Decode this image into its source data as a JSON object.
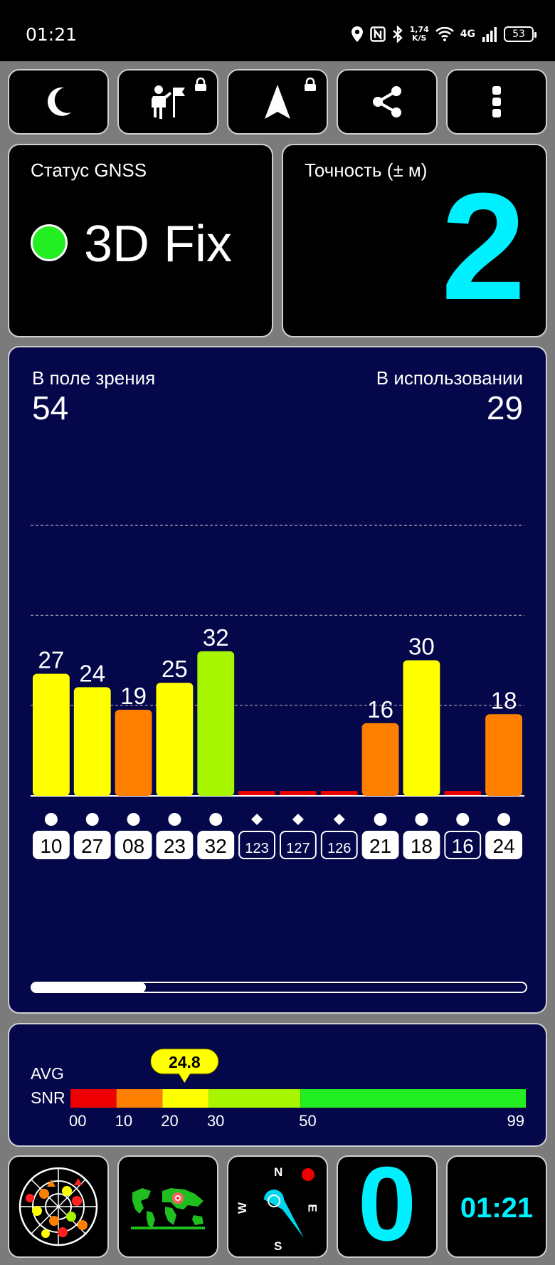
{
  "status_bar": {
    "time": "01:21",
    "speed_value": "1,74",
    "speed_unit": "K/S",
    "network": "4G",
    "battery": "53"
  },
  "toolbar": {
    "buttons": [
      {
        "icon": "moon-icon"
      },
      {
        "icon": "person-flag-icon",
        "locked": true
      },
      {
        "icon": "navigation-arrow-icon",
        "locked": true
      },
      {
        "icon": "share-icon"
      },
      {
        "icon": "more-vertical-icon"
      }
    ]
  },
  "status_card": {
    "title": "Статус GNSS",
    "value": "3D Fix",
    "dot_color": "#22ee22"
  },
  "accuracy_card": {
    "title": "Точность (± м)",
    "value": "2",
    "value_color": "#00f0ff"
  },
  "satellites": {
    "in_view_label": "В поле зрения",
    "in_view": "54",
    "in_use_label": "В использовании",
    "in_use": "29",
    "scroll_fraction": 0.23
  },
  "chart_data": {
    "type": "bar",
    "ylim": [
      0,
      60
    ],
    "gridlines": [
      20,
      40,
      60
    ],
    "bars": [
      {
        "id": "10",
        "snr": 27,
        "symbol": "circle"
      },
      {
        "id": "27",
        "snr": 24,
        "symbol": "circle"
      },
      {
        "id": "08",
        "snr": 19,
        "symbol": "circle"
      },
      {
        "id": "23",
        "snr": 25,
        "symbol": "circle"
      },
      {
        "id": "32",
        "snr": 32,
        "symbol": "circle"
      },
      {
        "id": "123",
        "snr": 0,
        "symbol": "diamond"
      },
      {
        "id": "127",
        "snr": 0,
        "symbol": "diamond"
      },
      {
        "id": "126",
        "snr": 0,
        "symbol": "diamond"
      },
      {
        "id": "21",
        "snr": 16,
        "symbol": "circle"
      },
      {
        "id": "18",
        "snr": 30,
        "symbol": "circle"
      },
      {
        "id": "16",
        "snr": 0,
        "symbol": "circle"
      },
      {
        "id": "24",
        "snr": 18,
        "symbol": "circle"
      }
    ],
    "used": [
      "10",
      "27",
      "08",
      "23",
      "32",
      "21",
      "18",
      "24"
    ],
    "colors": {
      "red": "#ee0000",
      "orange": "#ff8000",
      "yellow": "#ffff00",
      "lime": "#a8f500"
    }
  },
  "snr": {
    "label_line1": "AVG",
    "label_line2": "SNR",
    "avg": "24.8",
    "avg_value": 24.8,
    "ticks": [
      "00",
      "10",
      "20",
      "30",
      "50",
      "99"
    ],
    "segments": [
      {
        "to": 10,
        "color": "#ee0000"
      },
      {
        "to": 20,
        "color": "#ff8000"
      },
      {
        "to": 30,
        "color": "#ffff00"
      },
      {
        "to": 50,
        "color": "#a8f500"
      },
      {
        "to": 99,
        "color": "#22ee22"
      }
    ]
  },
  "bottom": {
    "compass": {
      "n": "N",
      "e": "E",
      "s": "S",
      "w": "W"
    },
    "satellites_in_use_big": "0",
    "clock": "01:21",
    "clock_color": "#00f0ff"
  }
}
